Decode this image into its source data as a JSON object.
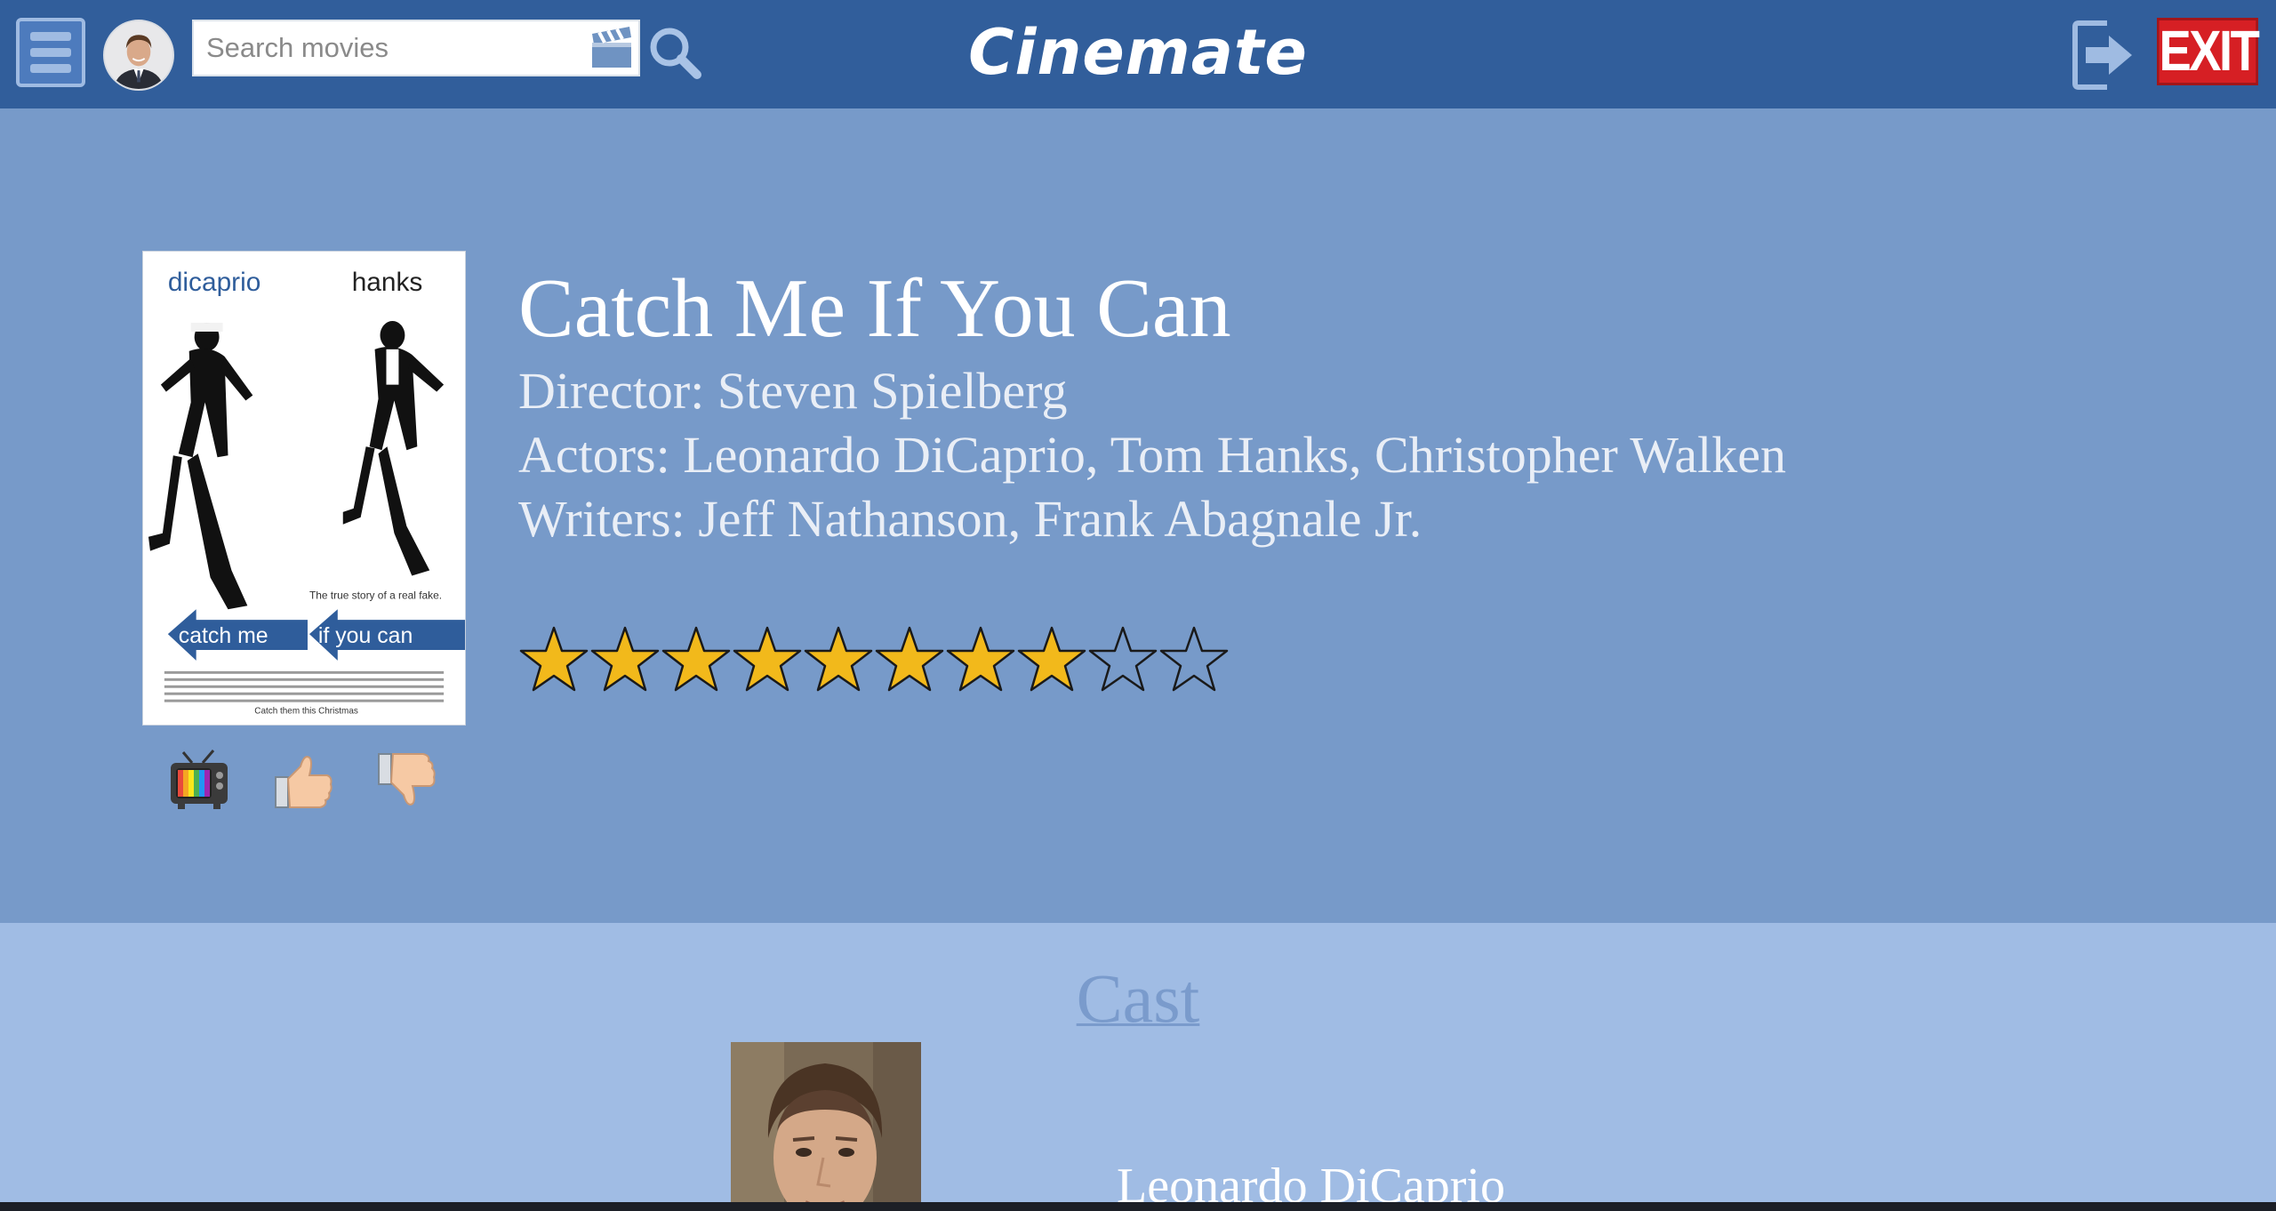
{
  "header": {
    "search_placeholder": "Search movies",
    "brand": "Cinemate",
    "exit_label": "EXIT"
  },
  "movie": {
    "title": "Catch Me If You Can",
    "director_line": "Director: Steven Spielberg",
    "actors_line": "Actors: Leonardo DiCaprio, Tom Hanks, Christopher Walken",
    "writers_line": "Writers: Jeff Nathanson, Frank Abagnale Jr.",
    "rating": 8,
    "rating_max": 10,
    "poster": {
      "left_name": "dicaprio",
      "right_name": "hanks",
      "tagline": "The true story of a real fake.",
      "arrow_left": "catch me",
      "arrow_right": "if you can",
      "footer": "Catch them this Christmas"
    }
  },
  "actions": {
    "watch_icon": "tv-icon",
    "like_icon": "thumbs-up-icon",
    "dislike_icon": "thumbs-down-icon"
  },
  "cast": {
    "heading": "Cast",
    "members": [
      {
        "name": "Leonardo DiCaprio"
      }
    ]
  },
  "colors": {
    "header_bg": "#315e9b",
    "detail_bg": "#779ac9",
    "cast_bg": "#a0bce4",
    "star_fill": "#f2b91b",
    "exit_red": "#d61f24"
  }
}
